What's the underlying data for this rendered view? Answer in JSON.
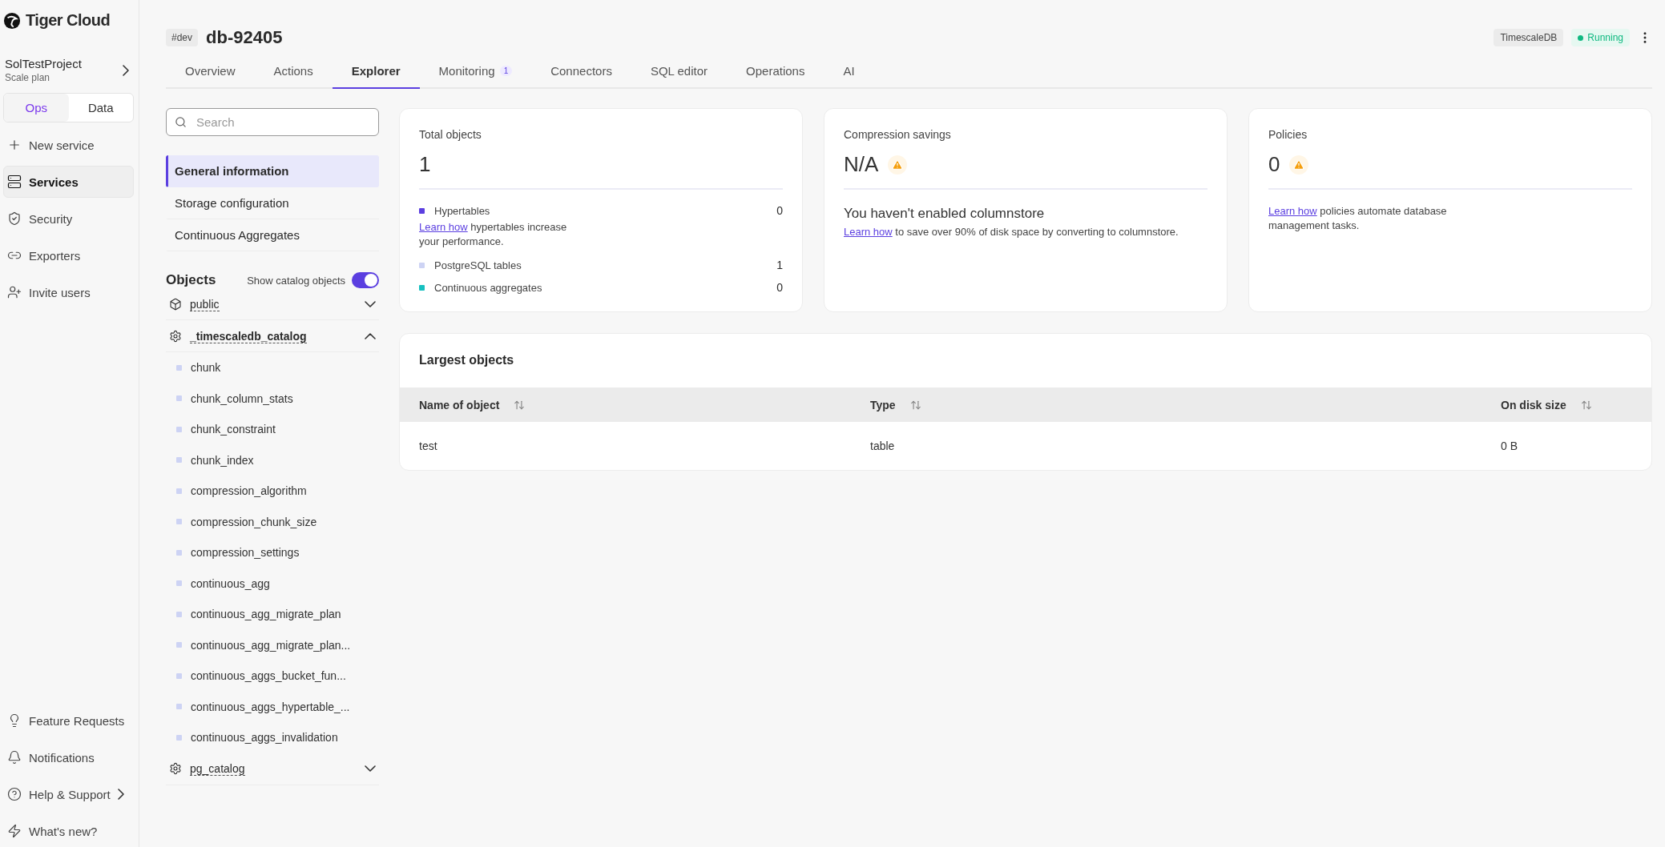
{
  "sidebar": {
    "logo": "Tiger Cloud",
    "project": {
      "name": "SolTestProject",
      "plan": "Scale plan"
    },
    "mode_tabs": [
      {
        "label": "Ops",
        "selected": true
      },
      {
        "label": "Data",
        "selected": false
      }
    ],
    "items": [
      {
        "label": "New service",
        "selected": false
      },
      {
        "label": "Services",
        "selected": true
      },
      {
        "label": "Security",
        "selected": false
      },
      {
        "label": "Exporters",
        "selected": false
      },
      {
        "label": "Invite users",
        "selected": false
      }
    ],
    "footer_items": [
      {
        "label": "Feature Requests",
        "has_arrow": false
      },
      {
        "label": "Notifications",
        "has_arrow": false
      },
      {
        "label": "Help & Support",
        "has_arrow": true
      },
      {
        "label": "What's new?",
        "has_arrow": false
      }
    ]
  },
  "header": {
    "env_tag": "#dev",
    "title": "db-92405",
    "engine": "TimescaleDB",
    "status": "Running"
  },
  "tabs": [
    {
      "label": "Overview",
      "selected": false
    },
    {
      "label": "Actions",
      "selected": false
    },
    {
      "label": "Explorer",
      "selected": true
    },
    {
      "label": "Monitoring",
      "selected": false,
      "badge": "1"
    },
    {
      "label": "Connectors",
      "selected": false
    },
    {
      "label": "SQL editor",
      "selected": false
    },
    {
      "label": "Operations",
      "selected": false
    },
    {
      "label": "AI",
      "selected": false
    }
  ],
  "explorer": {
    "search": {
      "placeholder": "Search"
    },
    "sections": [
      {
        "label": "General information",
        "selected": true
      },
      {
        "label": "Storage configuration",
        "selected": false
      },
      {
        "label": "Continuous Aggregates",
        "selected": false
      }
    ],
    "objects_title": "Objects",
    "catalog_toggle": {
      "label": "Show catalog objects",
      "on": true
    },
    "schemas": [
      {
        "name": "public",
        "kind": "box",
        "expanded": false
      },
      {
        "name": "_timescaledb_catalog",
        "kind": "gear",
        "expanded": true,
        "children": [
          "chunk",
          "chunk_column_stats",
          "chunk_constraint",
          "chunk_index",
          "compression_algorithm",
          "compression_chunk_size",
          "compression_settings",
          "continuous_agg",
          "continuous_agg_migrate_plan",
          "continuous_agg_migrate_plan...",
          "continuous_aggs_bucket_fun...",
          "continuous_aggs_hypertable_...",
          "continuous_aggs_invalidation"
        ]
      },
      {
        "name": "pg_catalog",
        "kind": "gear",
        "expanded": false
      }
    ]
  },
  "cards": [
    {
      "kind": "totals",
      "title": "Total objects",
      "value": "1",
      "legend": [
        {
          "label": "Hypertables",
          "value": "0",
          "color": "#5b3fe0",
          "link": "Learn how",
          "note": " hypertables increase your performance."
        },
        {
          "label": "PostgreSQL tables",
          "value": "1",
          "color": "#cdd3f4"
        },
        {
          "label": "Continuous aggregates",
          "value": "0",
          "color": "#17c0c0"
        }
      ]
    },
    {
      "kind": "compression",
      "title": "Compression savings",
      "value": "N/A",
      "warning": true,
      "heading": "You haven't enabled columnstore",
      "link": "Learn how",
      "note": " to save over 90% of disk space by converting to columnstore."
    },
    {
      "kind": "policies",
      "title": "Policies",
      "value": "0",
      "warning": true,
      "link": "Learn how",
      "note": " policies automate database management tasks."
    }
  ],
  "largest": {
    "title": "Largest objects",
    "columns": [
      "Name of object",
      "Type",
      "On disk size"
    ],
    "rows": [
      [
        "test",
        "table",
        "0 B"
      ]
    ]
  }
}
